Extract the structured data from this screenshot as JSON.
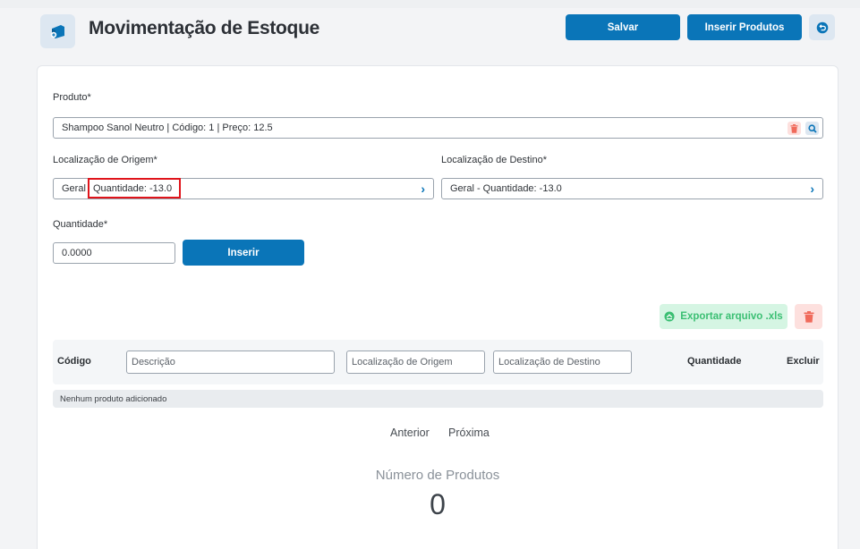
{
  "header": {
    "title": "Movimentação de Estoque",
    "save_label": "Salvar",
    "insert_products_label": "Inserir Produtos",
    "icon": "box-icon",
    "undo_icon": "undo-icon"
  },
  "form": {
    "produto_label": "Produto*",
    "produto_value": "Shampoo Sanol Neutro | Código: 1 | Preço: 12.5",
    "origem_label": "Localização de Origem*",
    "origem_prefix": "Geral",
    "origem_highlight": "Quantidade: -13.0",
    "destino_label": "Localização de Destino*",
    "destino_value": "Geral - Quantidade: -13.0",
    "quantidade_label": "Quantidade*",
    "quantidade_value": "0.0000",
    "inserir_label": "Inserir"
  },
  "actions": {
    "export_label": "Exportar arquivo .xls"
  },
  "table": {
    "col_codigo": "Código",
    "descricao_placeholder": "Descrição",
    "origem_placeholder": "Localização de Origem",
    "destino_placeholder": "Localização de Destino",
    "col_quantidade": "Quantidade",
    "col_excluir": "Excluir",
    "empty_text": "Nenhum produto adicionado"
  },
  "pagination": {
    "prev": "Anterior",
    "next": "Próxima"
  },
  "summary": {
    "label": "Número de Produtos",
    "value": "0"
  },
  "colors": {
    "primary": "#0a75b8",
    "export_bg": "#d5f5e3",
    "export_text": "#3bbf73",
    "danger_bg": "#fde0de",
    "danger": "#f06a5b",
    "highlight_border": "#e0141b"
  }
}
